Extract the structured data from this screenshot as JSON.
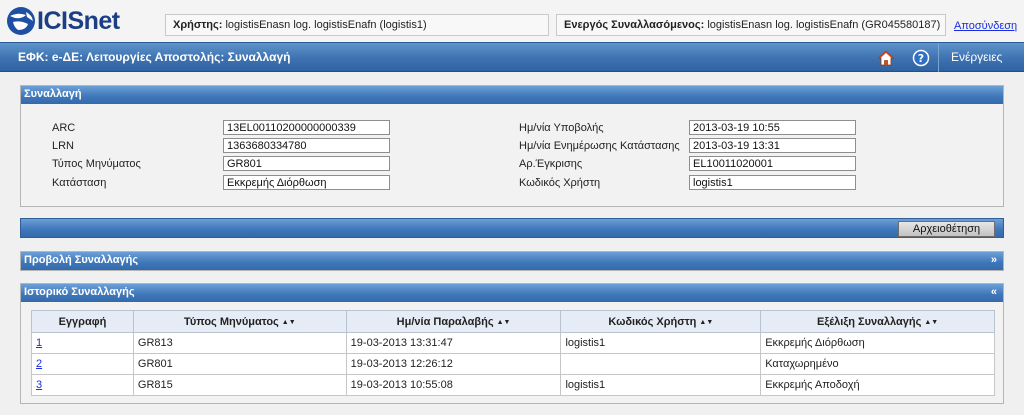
{
  "header": {
    "logo_text": "ICISnet",
    "user_label": "Χρήστης:",
    "user_value": "logistisEnasn log. logistisEnafn (logistis1)",
    "trader_label": "Ενεργός Συναλλασόμενος:",
    "trader_value": "logistisEnasn log. logistisEnafn (GR045580187)",
    "logout": "Αποσύνδεση"
  },
  "titlebar": {
    "title": "ΕΦΚ: e-ΔΕ: Λειτουργίες Αποστολής: Συναλλαγή",
    "home_icon": "home-icon",
    "help_icon": "help-icon",
    "actions": "Ενέργειες"
  },
  "transaction": {
    "heading": "Συναλλαγή",
    "left_fields": [
      {
        "label": "ARC",
        "value": "13EL00110200000000339"
      },
      {
        "label": "LRN",
        "value": "1363680334780"
      },
      {
        "label": "Τύπος Μηνύματος",
        "value": "GR801"
      },
      {
        "label": "Κατάσταση",
        "value": "Εκκρεμής Διόρθωση"
      }
    ],
    "right_fields": [
      {
        "label": "Ημ/νία Υποβολής",
        "value": "2013-03-19 10:55"
      },
      {
        "label": "Ημ/νία Ενημέρωσης Κατάστασης",
        "value": "2013-03-19 13:31"
      },
      {
        "label": "Αρ.Έγκρισης",
        "value": "EL10011020001"
      },
      {
        "label": "Κωδικός Χρήστη",
        "value": "logistis1"
      }
    ]
  },
  "archive_button": "Αρχειοθέτηση",
  "view_panel": {
    "heading": "Προβολή Συναλλαγής",
    "toggle": "»"
  },
  "history": {
    "heading": "Ιστορικό Συναλλαγής",
    "toggle": "«",
    "columns": [
      "Εγγραφή",
      "Τύπος Μηνύματος",
      "Ημ/νία Παραλαβής",
      "Κωδικός Χρήστη",
      "Εξέλιξη Συναλλαγής"
    ],
    "sort_icon": "▲▼",
    "rows": [
      [
        "1",
        "GR813",
        "19-03-2013 13:31:47",
        "logistis1",
        "Εκκρεμής Διόρθωση"
      ],
      [
        "2",
        "GR801",
        "19-03-2013 12:26:12",
        "",
        "Καταχωρημένο"
      ],
      [
        "3",
        "GR815",
        "19-03-2013 10:55:08",
        "logistis1",
        "Εκκρεμής Αποδοχή"
      ]
    ]
  },
  "colors": {
    "accent": "#3f76b8",
    "link": "#1a2ee0",
    "logo": "#1b3e84"
  }
}
